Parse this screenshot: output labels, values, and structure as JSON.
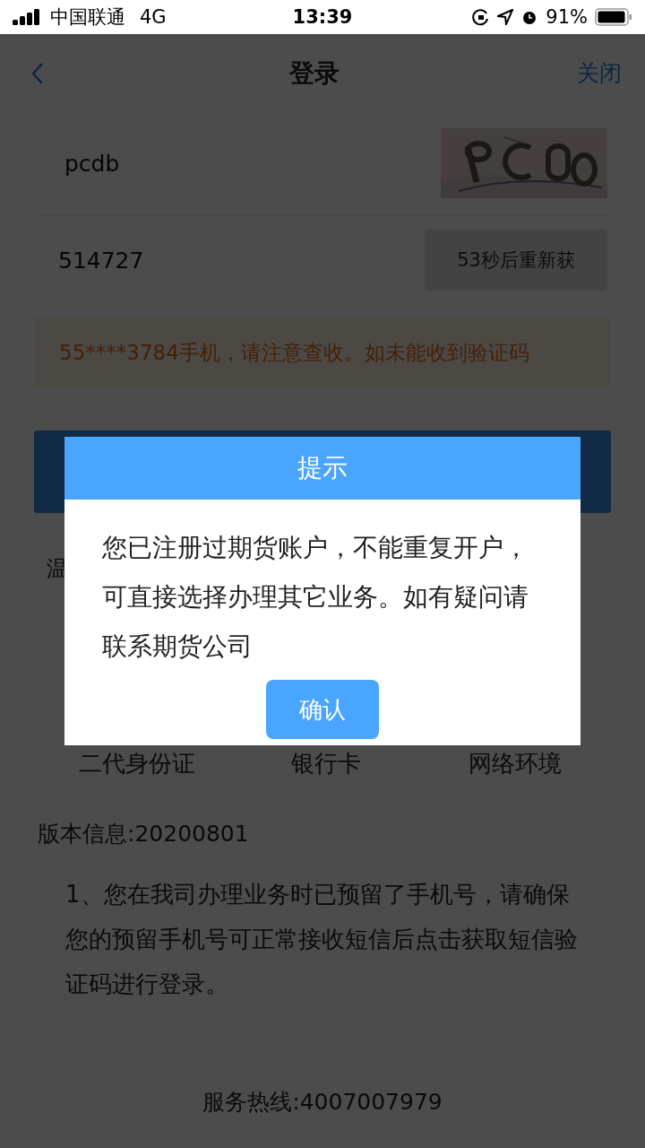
{
  "status_bar": {
    "carrier": "中国联通",
    "network": "4G",
    "time": "13:39",
    "battery": "91%"
  },
  "nav": {
    "title": "登录",
    "close": "关闭"
  },
  "form": {
    "username": "pcdb",
    "sms_code": "514727",
    "resend_button": {
      "label": "53秒后重新获",
      "disabled": true
    },
    "notice": "55****3784手机，请注意查收。如未能收到验证码"
  },
  "tips_heading": "温",
  "check_items": [
    {
      "label": "二代身份证"
    },
    {
      "label": "银行卡"
    },
    {
      "label": "网络环境"
    }
  ],
  "version": "版本信息:20200801",
  "instructions": [
    "1、您在我司办理业务时已预留了手机号，请确保您的预留手机号可正常接收短信后点击获取短信验证码进行登录。"
  ],
  "hotline": "服务热线:4007007979",
  "dialog": {
    "title": "提示",
    "message": "您已注册过期货账户，不能重复开户，可直接选择办理其它业务。如有疑问请联系期货公司",
    "confirm": "确认"
  }
}
